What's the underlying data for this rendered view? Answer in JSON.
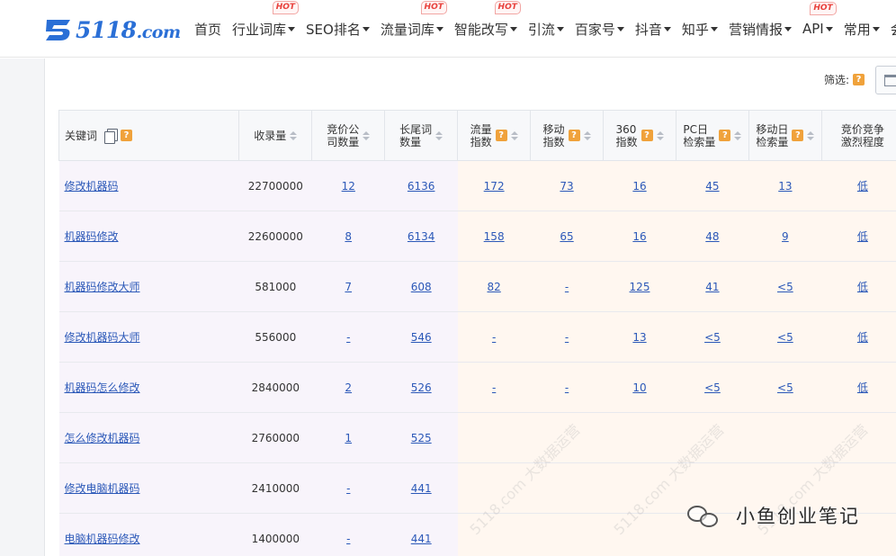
{
  "logo": {
    "text_main": "5118",
    "text_suffix": ".com",
    "brand_color": "#2a6fd6"
  },
  "nav": [
    {
      "label": "首页",
      "dropdown": false,
      "hot": false
    },
    {
      "label": "行业词库",
      "dropdown": true,
      "hot": true
    },
    {
      "label": "SEO排名",
      "dropdown": true,
      "hot": false
    },
    {
      "label": "流量词库",
      "dropdown": true,
      "hot": true
    },
    {
      "label": "智能改写",
      "dropdown": true,
      "hot": true
    },
    {
      "label": "引流",
      "dropdown": true,
      "hot": false
    },
    {
      "label": "百家号",
      "dropdown": true,
      "hot": false
    },
    {
      "label": "抖音",
      "dropdown": true,
      "hot": false
    },
    {
      "label": "知乎",
      "dropdown": true,
      "hot": false
    },
    {
      "label": "营销情报",
      "dropdown": true,
      "hot": false
    },
    {
      "label": "API",
      "dropdown": true,
      "hot": true
    },
    {
      "label": "常用",
      "dropdown": true,
      "hot": false
    },
    {
      "label": "会",
      "dropdown": false,
      "hot": false
    }
  ],
  "hot_label": "HOT",
  "filter": {
    "label": "筛选:",
    "help": "?"
  },
  "table": {
    "headers": [
      {
        "label": "关键词",
        "copy": true,
        "help": true,
        "sort": false
      },
      {
        "label": "收录量",
        "copy": false,
        "help": false,
        "sort": true
      },
      {
        "label": "竞价公\n司数量",
        "copy": false,
        "help": false,
        "sort": true
      },
      {
        "label": "长尾词\n数量",
        "copy": false,
        "help": false,
        "sort": true
      },
      {
        "label": "流量\n指数",
        "copy": false,
        "help": true,
        "sort": true
      },
      {
        "label": "移动\n指数",
        "copy": false,
        "help": true,
        "sort": true
      },
      {
        "label": "360\n指数",
        "copy": false,
        "help": true,
        "sort": true
      },
      {
        "label": "PC日\n检索量",
        "copy": false,
        "help": true,
        "sort": true
      },
      {
        "label": "移动日\n检索量",
        "copy": false,
        "help": true,
        "sort": true
      },
      {
        "label": "竞价竞争\n激烈程度",
        "copy": false,
        "help": false,
        "sort": false
      }
    ],
    "rows": [
      [
        "修改机器码",
        "22700000",
        "12",
        "6136",
        "172",
        "73",
        "16",
        "45",
        "13",
        "低"
      ],
      [
        "机器码修改",
        "22600000",
        "8",
        "6134",
        "158",
        "65",
        "16",
        "48",
        "9",
        "低"
      ],
      [
        "机器码修改大师",
        "581000",
        "7",
        "608",
        "82",
        "-",
        "125",
        "41",
        "<5",
        "低"
      ],
      [
        "修改机器码大师",
        "556000",
        "-",
        "546",
        "-",
        "-",
        "13",
        "<5",
        "<5",
        "低"
      ],
      [
        "机器码怎么修改",
        "2840000",
        "2",
        "526",
        "-",
        "-",
        "10",
        "<5",
        "<5",
        "低"
      ],
      [
        "怎么修改机器码",
        "2760000",
        "1",
        "525",
        "",
        "",
        "",
        "",
        "",
        ""
      ],
      [
        "修改电脑机器码",
        "2410000",
        "-",
        "441",
        "",
        "",
        "",
        "",
        "",
        ""
      ],
      [
        "电脑机器码修改",
        "1400000",
        "-",
        "441",
        "",
        "",
        "",
        "",
        "",
        ""
      ]
    ]
  },
  "watermark": "5118.com 大数据运营",
  "wechat_caption": "小鱼创业笔记"
}
